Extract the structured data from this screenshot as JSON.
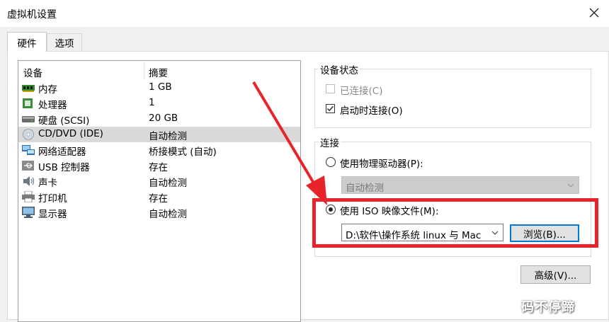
{
  "window": {
    "title": "虚拟机设置"
  },
  "tabs": [
    {
      "label": "硬件",
      "active": true
    },
    {
      "label": "选项",
      "active": false
    }
  ],
  "device_list": {
    "columns": [
      "设备",
      "摘要"
    ],
    "rows": [
      {
        "name": "内存",
        "summary": "1 GB",
        "icon": "memory-icon"
      },
      {
        "name": "处理器",
        "summary": "1",
        "icon": "processor-icon"
      },
      {
        "name": "硬盘 (SCSI)",
        "summary": "20 GB",
        "icon": "hard-disk-icon"
      },
      {
        "name": "CD/DVD (IDE)",
        "summary": "自动检测",
        "icon": "cd-dvd-icon",
        "selected": true
      },
      {
        "name": "网络适配器",
        "summary": "桥接模式 (自动)",
        "icon": "network-adapter-icon"
      },
      {
        "name": "USB 控制器",
        "summary": "存在",
        "icon": "usb-icon"
      },
      {
        "name": "声卡",
        "summary": "自动检测",
        "icon": "sound-card-icon"
      },
      {
        "name": "打印机",
        "summary": "存在",
        "icon": "printer-icon"
      },
      {
        "name": "显示器",
        "summary": "自动检测",
        "icon": "monitor-icon"
      }
    ]
  },
  "device_status": {
    "title": "设备状态",
    "connected": {
      "label": "已连接(C)",
      "checked": false,
      "enabled": false
    },
    "connect_at_power_on": {
      "label": "启动时连接(O)",
      "checked": true,
      "enabled": true
    }
  },
  "connection": {
    "title": "连接",
    "physical_drive": {
      "label": "使用物理驱动器(P):",
      "selected": false,
      "value": "自动检测"
    },
    "iso_image": {
      "label": "使用 ISO 映像文件(M):",
      "selected": true,
      "value": "D:\\软件\\操作系统 linux 与 Mac"
    },
    "browse_label": "浏览(B)..."
  },
  "advanced_label": "高级(V)...",
  "watermark": "码不停蹄",
  "colors": {
    "highlight": "#e8232a",
    "focus": "#0078d7",
    "selected_row": "#d9d9d9"
  }
}
